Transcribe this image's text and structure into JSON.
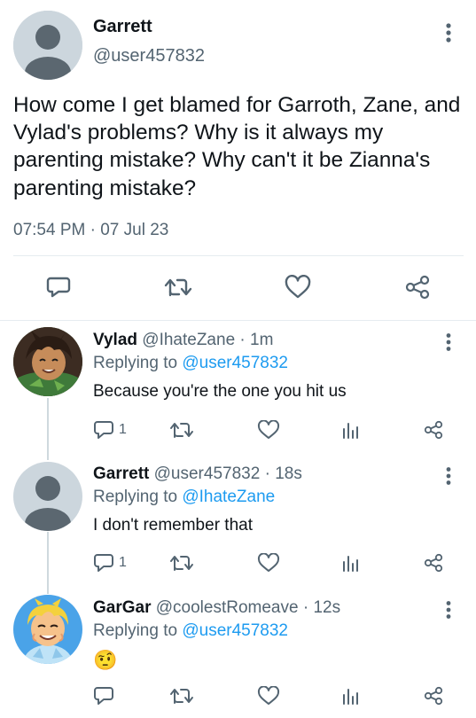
{
  "main_tweet": {
    "name": "Garrett",
    "handle": "@user457832",
    "text": "How come I get blamed for Garroth, Zane, and Vylad's problems? Why is it always my parenting mistake? Why can't it be Zianna's parenting mistake?",
    "time": "07:54 PM",
    "date": "07 Jul 23",
    "time_separator": "·",
    "icons": {
      "reply": "reply-icon",
      "retweet": "retweet-icon",
      "like": "like-icon",
      "share": "share-icon",
      "more": "more-vertical-icon"
    }
  },
  "replies": [
    {
      "name": "Vylad",
      "handle": "@IhateZane",
      "separator": "·",
      "time": "1m",
      "replying_prefix": "Replying to",
      "replying_to": "@user457832",
      "text": "Because you're the one you hit us",
      "reply_count": "1",
      "avatar": "cartoon character avatar"
    },
    {
      "name": "Garrett",
      "handle": "@user457832",
      "separator": "·",
      "time": "18s",
      "replying_prefix": "Replying to",
      "replying_to": "@IhateZane",
      "text": "I don't remember that",
      "reply_count": "1",
      "avatar": "default profile avatar"
    },
    {
      "name": "GarGar",
      "handle": "@coolestRomeave",
      "separator": "·",
      "time": "12s",
      "replying_prefix": "Replying to",
      "replying_to": "@user457832",
      "text": "🤨",
      "reply_count": "",
      "avatar": "cartoon character avatar"
    }
  ],
  "colors": {
    "text": "#0f1419",
    "secondary": "#536471",
    "link": "#1d9bf0",
    "divider": "#e6ecf0",
    "thread_line": "#cfd9de",
    "default_avatar_bg": "#ccd6dd",
    "default_avatar_fg": "#5b6770"
  }
}
